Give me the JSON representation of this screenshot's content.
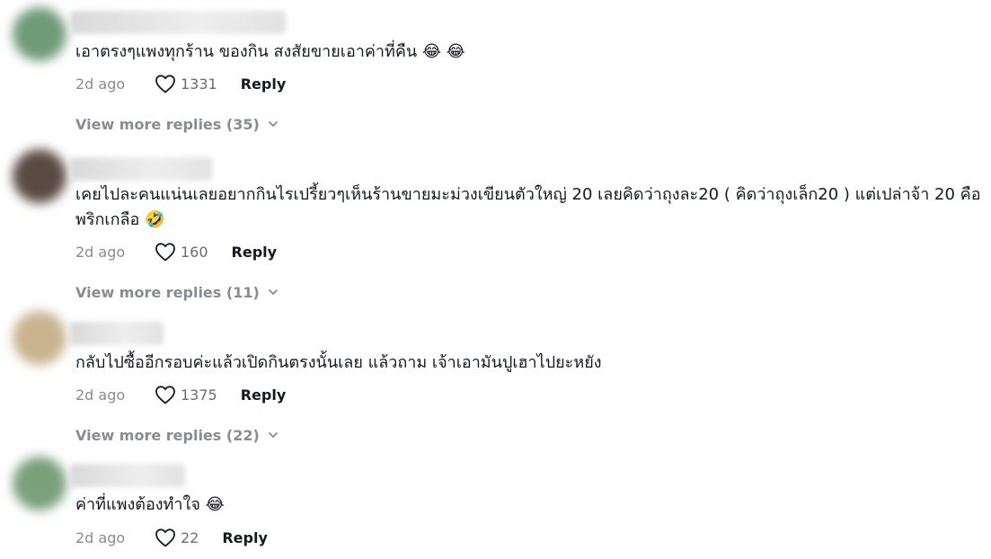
{
  "comments": [
    {
      "text": "เอาตรงๆแพงทุกร้าน ของกิน สงสัยขายเอาค่าที่คืน 😂 😂",
      "time": "2d ago",
      "likes": "1331",
      "reply_label": "Reply",
      "more_replies": "View more replies (35)",
      "avatar_color": "#6f9b78"
    },
    {
      "text": "เคยไปละคนแน่นเลยอยากกินไรเปรี้ยวๆเห็นร้านขายมะม่วงเขียนตัวใหญ่ 20 เลยคิดว่าถุงละ20 ( คิดว่าถุงเล็ก20 ) แต่เปล่าจ้า 20 คือพริกเกลือ 🤣",
      "time": "2d ago",
      "likes": "160",
      "reply_label": "Reply",
      "more_replies": "View more replies (11)",
      "avatar_color": "#5a4a44"
    },
    {
      "text": "กลับไปซื้ออีกรอบค่ะแล้วเปิดกินตรงนั้นเลย แล้วถาม เจ้าเอามันปูเฮาไปยะหยัง",
      "time": "2d ago",
      "likes": "1375",
      "reply_label": "Reply",
      "more_replies": "View more replies (22)",
      "avatar_color": "#c9b48e"
    },
    {
      "text": "ค่าที่แพงต้องทำใจ 😂",
      "time": "2d ago",
      "likes": "22",
      "reply_label": "Reply",
      "more_replies": "",
      "avatar_color": "#7aa07c"
    }
  ],
  "icons": {
    "like": "heart-outline-icon",
    "expand": "chevron-down-icon"
  },
  "colors": {
    "text": "#161823",
    "muted": "#8a8b91"
  }
}
